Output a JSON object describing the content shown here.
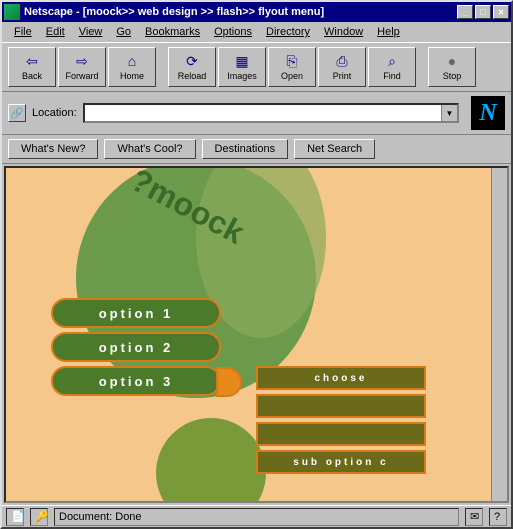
{
  "titlebar": {
    "text": "Netscape - [moock>> web design >> flash>> flyout menu]"
  },
  "menu": {
    "file": "File",
    "edit": "Edit",
    "view": "View",
    "go": "Go",
    "bookmarks": "Bookmarks",
    "options": "Options",
    "directory": "Directory",
    "window": "Window",
    "help": "Help"
  },
  "toolbar": {
    "back": "Back",
    "forward": "Forward",
    "home": "Home",
    "reload": "Reload",
    "images": "Images",
    "open": "Open",
    "print": "Print",
    "find": "Find",
    "stop": "Stop"
  },
  "location": {
    "label": "Location:",
    "value": ""
  },
  "dir": {
    "whatsnew": "What's New?",
    "whatscool": "What's Cool?",
    "destinations": "Destinations",
    "netsearch": "Net Search"
  },
  "flash": {
    "brand": "?moock",
    "opt1": "option 1",
    "opt2": "option 2",
    "opt3": "option 3",
    "choose": "choose",
    "sub_a": "",
    "sub_b": "",
    "sub_c": "sub option c"
  },
  "status": {
    "text": "Document: Done"
  }
}
